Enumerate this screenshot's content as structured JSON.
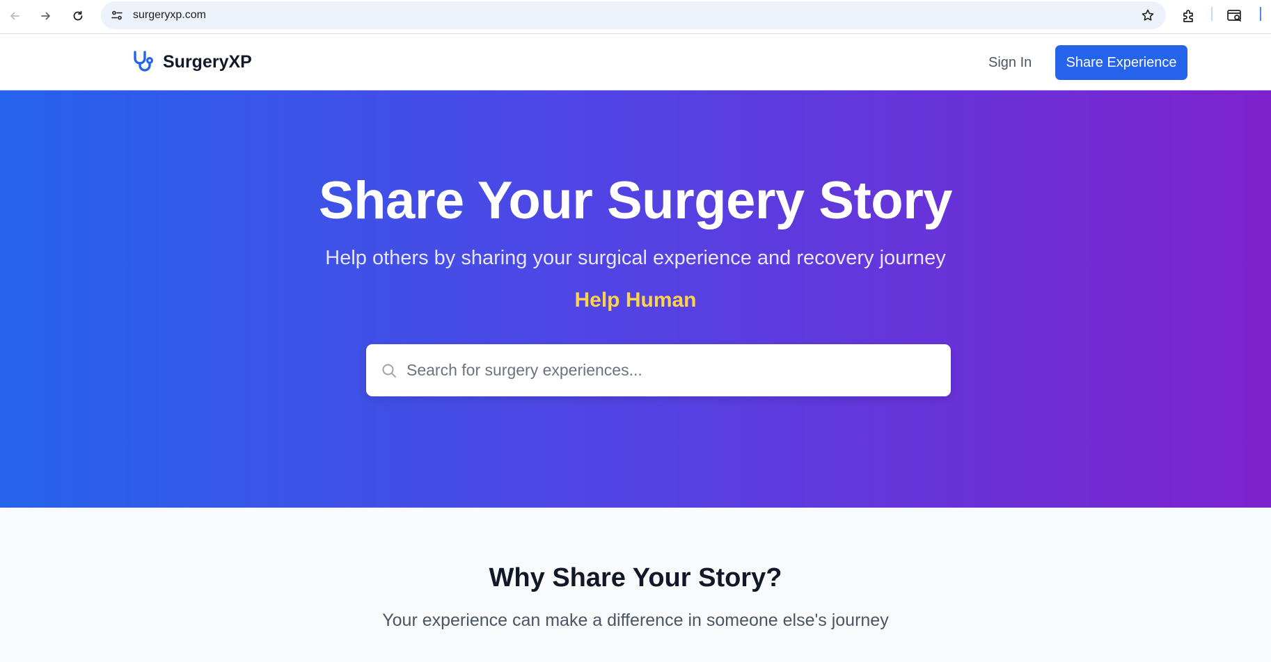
{
  "browser": {
    "url": "surgeryxp.com"
  },
  "header": {
    "logo_text": "SurgeryXP",
    "sign_in": "Sign In",
    "share_button": "Share Experience"
  },
  "hero": {
    "title": "Share Your Surgery Story",
    "subtitle": "Help others by sharing your surgical experience and recovery journey",
    "tagline": "Help Human",
    "search_placeholder": "Search for surgery experiences...",
    "search_value": ""
  },
  "why": {
    "title": "Why Share Your Story?",
    "subtitle": "Your experience can make a difference in someone else's journey"
  },
  "colors": {
    "primary": "#2563eb",
    "gradient_start": "#2563eb",
    "gradient_end": "#7e22ce",
    "tagline": "#fcd34d",
    "section_bg": "#f8fafc"
  }
}
